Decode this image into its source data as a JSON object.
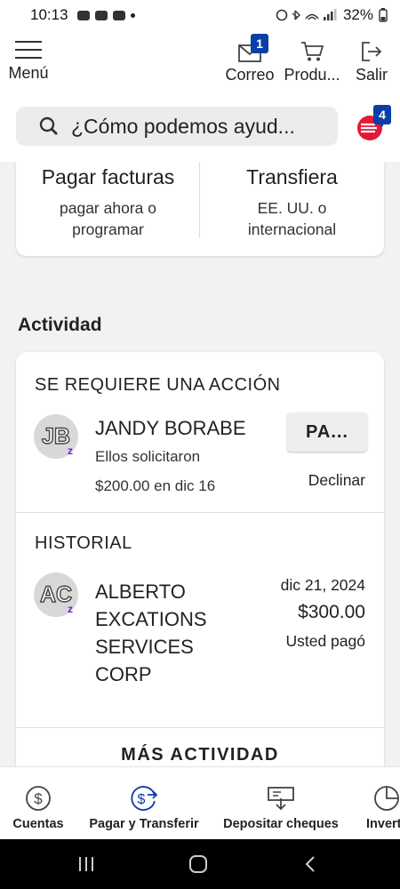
{
  "status_bar": {
    "time": "10:13",
    "battery": "32%"
  },
  "header": {
    "menu_label": "Menú",
    "mail_label": "Correo",
    "mail_badge": "1",
    "products_label": "Produ...",
    "exit_label": "Salir"
  },
  "search": {
    "placeholder": "¿Cómo podemos ayud...",
    "erica_badge": "4"
  },
  "quick_actions": {
    "pay_bills": {
      "title": "Pagar facturas",
      "subtitle": "pagar ahora o programar"
    },
    "transfer": {
      "title": "Transfiera",
      "subtitle": "EE. UU. o internacional"
    }
  },
  "activity": {
    "title": "Actividad",
    "action_required": {
      "heading": "SE REQUIERE UNA ACCIÓN",
      "avatar_initials": "JB",
      "name": "JANDY BORABE",
      "description": "Ellos solicitaron",
      "amount_date": "$200.00 en dic 16",
      "pay_button": "PA...",
      "decline_link": "Declinar"
    },
    "history": {
      "heading": "HISTORIAL",
      "avatar_initials": "AC",
      "name": "ALBERTO EXCATIONS SERVICES CORP",
      "date": "dic 21, 2024",
      "amount": "$300.00",
      "status": "Usted pagó"
    },
    "more_link": "MÁS ACTIVIDAD"
  },
  "bottom_nav": {
    "accounts": "Cuentas",
    "pay_transfer": "Pagar y Transferir",
    "deposit": "Depositar cheques",
    "invest": "Invert"
  },
  "colors": {
    "accent_blue": "#0a3fa8",
    "zelle_purple": "#6d1ed4",
    "erica_red": "#e31837"
  }
}
